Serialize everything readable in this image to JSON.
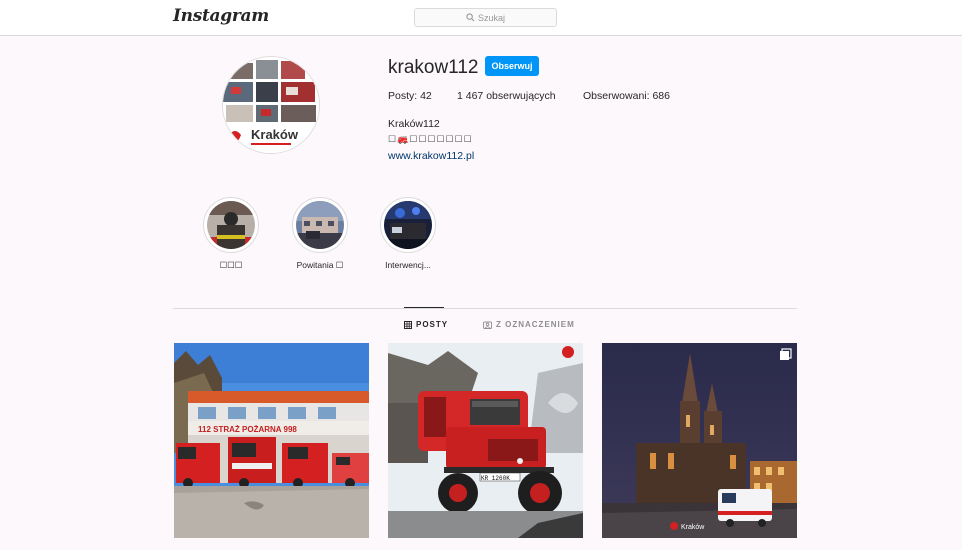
{
  "header": {
    "logo": "Instagram",
    "search_placeholder": "Szukaj"
  },
  "profile": {
    "username": "krakow112",
    "follow_label": "Obserwuj",
    "stats": {
      "posts": "Posty: 42",
      "followers": "1 467 obserwujących",
      "following": "Obserwowani: 686"
    },
    "bio_name": "Kraków112",
    "bio_line": "☐🚒☐☐☐☐☐☐☐",
    "website": "www.krakow112.pl",
    "avatar_logo_text": "Kraków"
  },
  "highlights": [
    {
      "label": "☐☐☐"
    },
    {
      "label": "Powitania ☐"
    },
    {
      "label": "Interwencj..."
    }
  ],
  "tabs": {
    "posts": "POSTY",
    "tagged": "Z OZNACZENIEM"
  },
  "posts": [
    {
      "alt": "fire station",
      "sign": "112 STRAŻ POŻARNA 998"
    },
    {
      "alt": "unimog fire truck",
      "plate": "KR 1260K"
    },
    {
      "alt": "st mary's basilica night ambulance",
      "watermark": "Kraków"
    }
  ],
  "colors": {
    "accent": "#0095f6",
    "fire_red": "#d42020"
  }
}
